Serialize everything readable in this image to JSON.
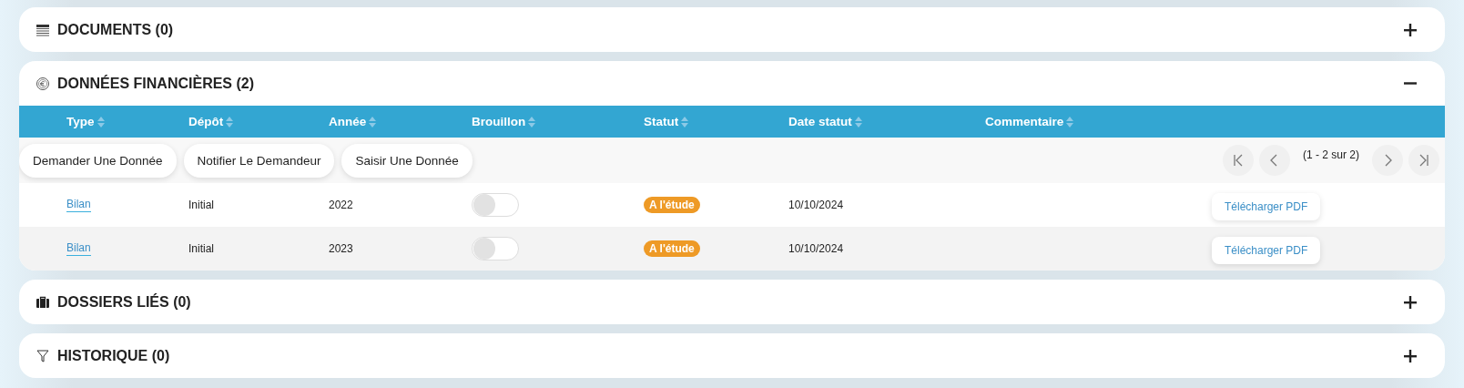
{
  "sections": [
    {
      "kind": "documents",
      "title": "DOCUMENTS (0)",
      "expanded": false
    },
    {
      "kind": "finance",
      "title": "DONNÉES FINANCIÈRES (2)",
      "expanded": true,
      "table": {
        "columns": [
          "Type",
          "Dépôt",
          "Année",
          "Brouillon",
          "Statut",
          "Date statut",
          "Commentaire"
        ],
        "actions": [
          "Demander Une Donnée",
          "Notifier Le Demandeur",
          "Saisir Une Donnée"
        ],
        "pagination": "(1 - 2 sur 2)",
        "rows": [
          {
            "type": "Bilan",
            "depot": "Initial",
            "annee": "2022",
            "brouillon": {
              "on": false
            },
            "statut": {
              "label": "A l'étude",
              "color": "#ee9a26"
            },
            "date": "10/10/2024",
            "download": "Télécharger PDF"
          },
          {
            "type": "Bilan",
            "depot": "Initial",
            "annee": "2023",
            "brouillon": {
              "on": false
            },
            "statut": {
              "label": "A l'étude",
              "color": "#ee9a26"
            },
            "date": "10/10/2024",
            "download": "Télécharger PDF"
          }
        ]
      }
    },
    {
      "kind": "folders",
      "title": "DOSSIERS LIÉS (0)",
      "expanded": false
    },
    {
      "kind": "history",
      "title": "HISTORIQUE (0)",
      "expanded": false
    }
  ]
}
